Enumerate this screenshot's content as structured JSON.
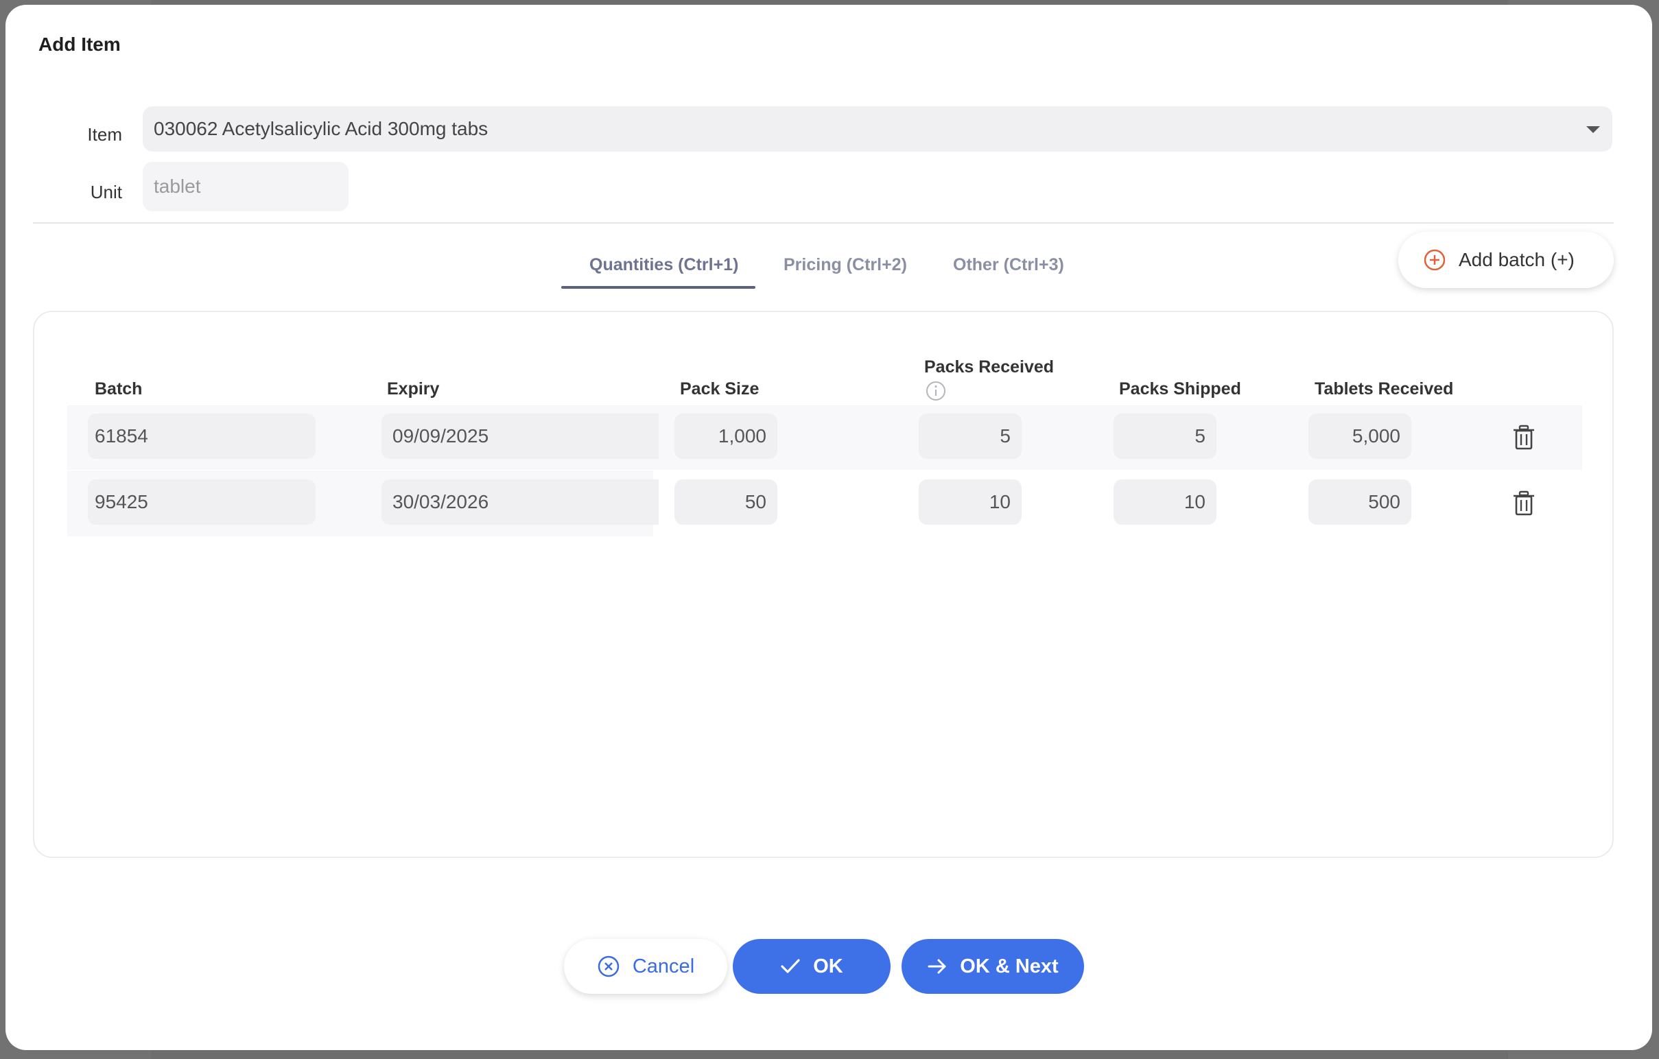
{
  "dialog": {
    "title": "Add Item"
  },
  "form": {
    "item_label": "Item",
    "item_value": "030062 Acetylsalicylic Acid 300mg tabs",
    "unit_label": "Unit",
    "unit_placeholder": "tablet"
  },
  "tabs": [
    {
      "label": "Quantities (Ctrl+1)",
      "active": true
    },
    {
      "label": "Pricing (Ctrl+2)",
      "active": false
    },
    {
      "label": "Other (Ctrl+3)",
      "active": false
    }
  ],
  "add_batch_label": "Add batch (+)",
  "table": {
    "headers": {
      "batch": "Batch",
      "expiry": "Expiry",
      "pack_size": "Pack Size",
      "packs_received": "Packs Received",
      "packs_shipped": "Packs Shipped",
      "units_received": "Tablets Received"
    },
    "rows": [
      {
        "batch": "61854",
        "expiry": "09/09/2025",
        "pack_size": "1,000",
        "packs_received": "5",
        "packs_shipped": "5",
        "units_received": "5,000"
      },
      {
        "batch": "95425",
        "expiry": "30/03/2026",
        "pack_size": "50",
        "packs_received": "10",
        "packs_shipped": "10",
        "units_received": "500"
      }
    ]
  },
  "buttons": {
    "cancel": "Cancel",
    "ok": "OK",
    "ok_next": "OK & Next"
  },
  "colors": {
    "primary": "#3e70e8",
    "add_icon": "#e0603a",
    "tab_active": "#5b6280"
  }
}
